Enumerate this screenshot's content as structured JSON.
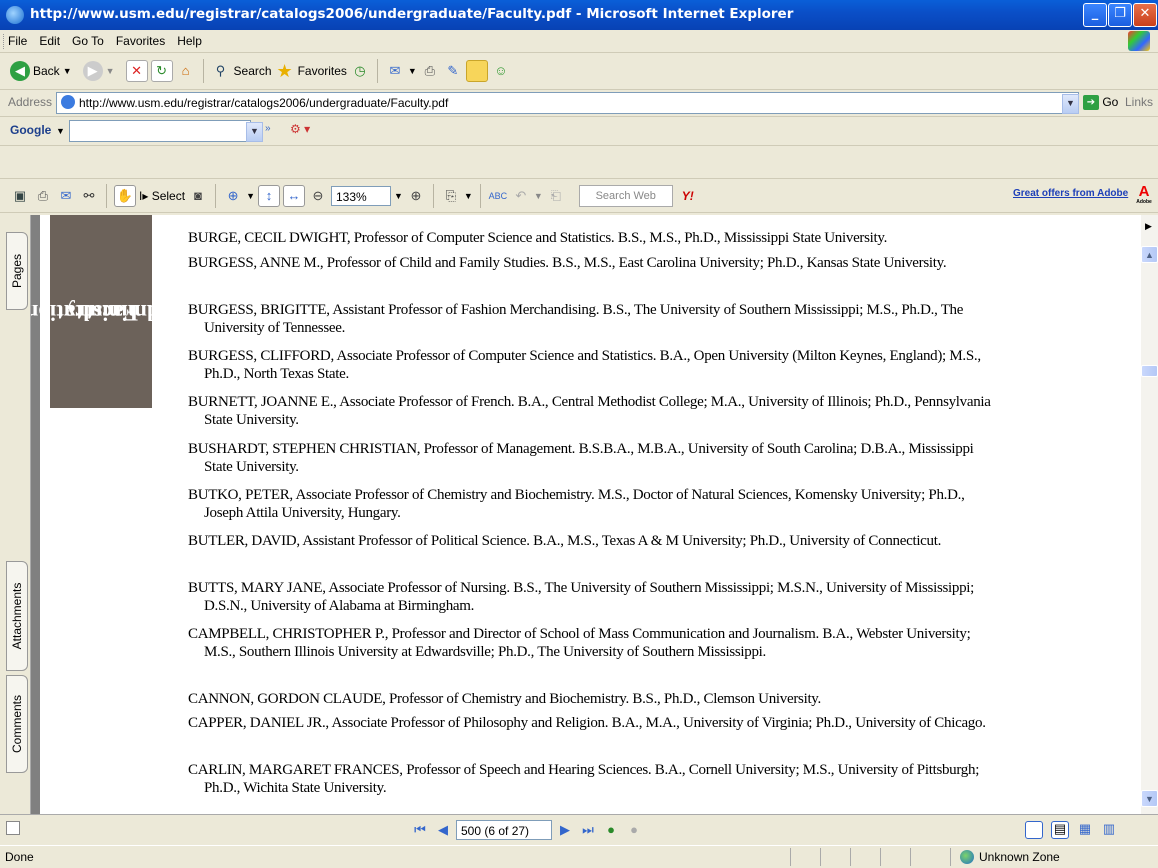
{
  "window": {
    "title": "http://www.usm.edu/registrar/catalogs2006/undergraduate/Faculty.pdf - Microsoft Internet Explorer"
  },
  "menu": [
    "File",
    "Edit",
    "Go To",
    "Favorites",
    "Help"
  ],
  "toolbar": {
    "back": "Back",
    "search": "Search",
    "favorites": "Favorites"
  },
  "address": {
    "label": "Address",
    "url": "http://www.usm.edu/registrar/catalogs2006/undergraduate/Faculty.pdf",
    "go": "Go",
    "links": "Links"
  },
  "google": {
    "label": "Google"
  },
  "pdf_toolbar": {
    "select": "Select",
    "zoom": "133%",
    "search_placeholder": "Search Web",
    "yahoo": "Y!",
    "adobe_offer": "Great offers from Adobe",
    "adobe_logo": "Adobe"
  },
  "side_tabs": {
    "pages": "Pages",
    "attachments": "Attachments",
    "comments": "Comments"
  },
  "document": {
    "band_line1": "Administration",
    "band_line2": "Faculty",
    "entries": [
      "BURGE, CECIL DWIGHT, Professor of Computer Science and Statistics. B.S., M.S., Ph.D., Mississippi State University.",
      "BURGESS, ANNE M., Professor of Child and Family Studies. B.S., M.S., East Carolina University; Ph.D., Kansas State University.",
      "BURGESS, BRIGITTE, Assistant Professor of Fashion Merchandising. B.S., The University of Southern Mississippi; M.S., Ph.D., The University of Tennessee.",
      "BURGESS, CLIFFORD, Associate Professor of Computer Science and Statistics. B.A., Open University (Milton Keynes, England); M.S., Ph.D., North Texas State.",
      "BURNETT, JOANNE E., Associate Professor of French. B.A., Central Methodist College; M.A., University of Illinois; Ph.D., Pennsylvania State University.",
      "BUSHARDT, STEPHEN CHRISTIAN, Professor of Management. B.S.B.A., M.B.A., University of South Carolina; D.B.A., Mississippi State University.",
      "BUTKO, PETER, Associate Professor of Chemistry and Biochemistry. M.S., Doctor of Natural Sciences, Komensky University; Ph.D., Joseph Attila University, Hungary.",
      "BUTLER, DAVID, Assistant Professor of Political Science. B.A., M.S., Texas A & M University; Ph.D., University of Connecticut.",
      "BUTTS, MARY JANE, Associate Professor of Nursing. B.S., The University of Southern Mississippi; M.S.N., University of Mississippi; D.S.N., University of Alabama at Birmingham.",
      "CAMPBELL, CHRISTOPHER P., Professor and Director of School of Mass Communication and Journalism. B.A., Webster University; M.S., Southern Illinois University at Edwardsville; Ph.D., The University of Southern Mississippi.",
      "CANNON, GORDON CLAUDE, Professor of Chemistry and Biochemistry. B.S., Ph.D., Clemson University.",
      "CAPPER, DANIEL JR., Associate Professor of Philosophy and Religion. B.A., M.A., University of Virginia; Ph.D., University of Chicago.",
      "CARLIN, MARGARET FRANCES, Professor of Speech and Hearing Sciences. B.A., Cornell University; M.S., University of Pittsburgh; Ph.D., Wichita State University."
    ]
  },
  "navigation": {
    "page_display": "500 (6 of 27)"
  },
  "status": {
    "left": "Done",
    "zone": "Unknown Zone"
  }
}
